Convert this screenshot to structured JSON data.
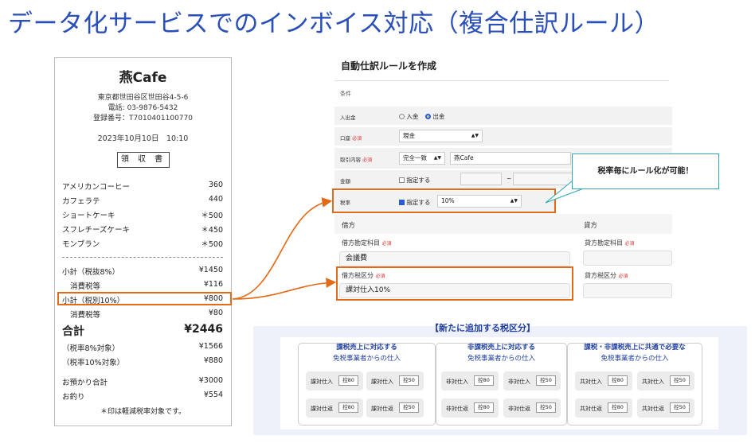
{
  "title": "データ化サービスでのインボイス対応（複合仕訳ルール）",
  "receipt": {
    "store": "燕Cafe",
    "address": "東京都世田谷区世田谷4-5-6",
    "phone": "電話: 03-9876-5432",
    "reg": "登録番号：T7010401100770",
    "datetime": "2023年10月10日　10:10",
    "stamp": "領 収 書",
    "items": [
      {
        "name": "アメリカンコーヒー",
        "price": "360"
      },
      {
        "name": "カフェラテ",
        "price": "440"
      },
      {
        "name": "ショートケーキ",
        "price": "＊500"
      },
      {
        "name": "スフレチーズケーキ",
        "price": "＊450"
      },
      {
        "name": "モンブラン",
        "price": "＊500"
      }
    ],
    "subtotal8": {
      "name": "小計（税抜8%）",
      "price": "¥1450"
    },
    "tax8": {
      "name": "消費税等",
      "price": "¥116"
    },
    "subtotal10": {
      "name": "小計（税別10%）",
      "price": "¥800"
    },
    "tax10": {
      "name": "消費税等",
      "price": "¥80"
    },
    "total": {
      "name": "合計",
      "price": "¥2446"
    },
    "target8": {
      "name": "（税率8%対象）",
      "price": "¥1566"
    },
    "target10": {
      "name": "（税率10%対象）",
      "price": "¥880"
    },
    "deposit": {
      "name": "お預かり合計",
      "price": "¥3000"
    },
    "change": {
      "name": "お釣り",
      "price": "¥554"
    },
    "note": "＊印は軽減税率対象です。"
  },
  "form": {
    "title": "自動仕訳ルールを作成",
    "condition": "条件",
    "deposit_label": "入出金",
    "radio_in": "入金",
    "radio_out": "出金",
    "account_label": "口座",
    "required": "必須",
    "account_value": "現金",
    "content_label": "取引内容",
    "match_value": "完全一致",
    "content_value": "燕Cafe",
    "amount_label": "金額",
    "specify": "指定する",
    "tilde": "~",
    "rate_label": "税率",
    "rate_value": "10%",
    "debit_header": "借方",
    "credit_header": "貸方",
    "debit_account_label": "借方勘定科目",
    "debit_account_value": "会議費",
    "credit_account_label": "貸方勘定科目",
    "debit_tax_label": "借方税区分",
    "debit_tax_value": "課対仕入10%",
    "credit_tax_label": "貸方税区分"
  },
  "callout": "税率毎にルール化が可能！",
  "tax_panel": {
    "title": "【新たに追加する税区分】",
    "columns": [
      {
        "title": "課税売上に対応する",
        "sub": "免税事業者からの仕入",
        "cells": [
          {
            "name": "課対仕入",
            "code": "控80"
          },
          {
            "name": "課対仕入",
            "code": "控50"
          },
          {
            "name": "課対仕返",
            "code": "控80"
          },
          {
            "name": "課対仕返",
            "code": "控50"
          }
        ]
      },
      {
        "title": "非課税売上に対応する",
        "sub": "免税事業者からの仕入",
        "cells": [
          {
            "name": "非対仕入",
            "code": "控80"
          },
          {
            "name": "非対仕入",
            "code": "控50"
          },
          {
            "name": "非対仕返",
            "code": "控80"
          },
          {
            "name": "非対仕返",
            "code": "控50"
          }
        ]
      },
      {
        "title": "課税・非課税売上に共通で必要な",
        "sub": "免税事業者からの仕入",
        "cells": [
          {
            "name": "共対仕入",
            "code": "控80"
          },
          {
            "name": "共対仕入",
            "code": "控50"
          },
          {
            "name": "共対仕返",
            "code": "控80"
          },
          {
            "name": "共対仕返",
            "code": "控50"
          }
        ]
      }
    ]
  },
  "colors": {
    "accent": "#2a4fb8",
    "highlight": "#e36a17",
    "callout_border": "#2aa8b4"
  }
}
